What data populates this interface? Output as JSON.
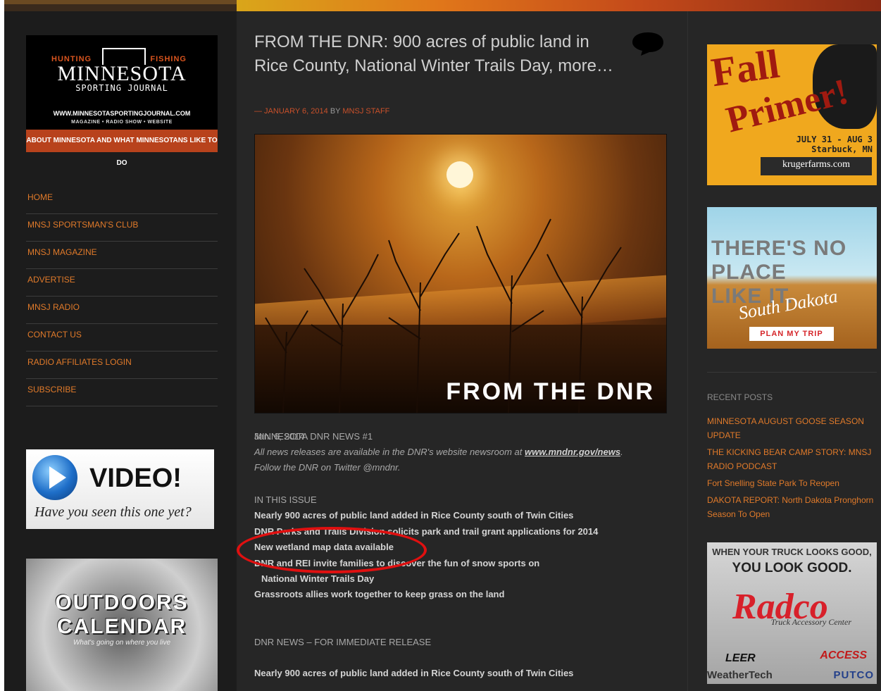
{
  "logo": {
    "hunting": "HUNTING",
    "fishing": "FISHING",
    "title": "MINNESOTA",
    "subtitle": "SPORTING JOURNAL",
    "url": "WWW.MINNESOTASPORTINGJOURNAL.COM",
    "tags": "MAGAZINE • RADIO SHOW • WEBSITE",
    "tagline": "ABOUT MINNESOTA AND WHAT MINNESOTANS LIKE TO DO"
  },
  "nav": [
    {
      "label": "HOME"
    },
    {
      "label": "MNSJ SPORTSMAN'S CLUB"
    },
    {
      "label": "MNSJ MAGAZINE"
    },
    {
      "label": "ADVERTISE"
    },
    {
      "label": "MNSJ RADIO"
    },
    {
      "label": "CONTACT US"
    },
    {
      "label": "RADIO AFFILIATES LOGIN"
    },
    {
      "label": "SUBSCRIBE"
    }
  ],
  "sidebar_ads": {
    "video_title": "VIDEO!",
    "video_sub": "Have you seen this one yet?",
    "calendar_line1": "OUTDOORS",
    "calendar_line2": "CALENDAR",
    "calendar_sub": "What's going on where you live"
  },
  "post": {
    "title": "FROM THE DNR: 900 acres of public land in Rice County, National Winter Trails Day, more…",
    "meta_date": "— JANUARY 6, 2014",
    "meta_by": "BY",
    "meta_author": "MNSJ STAFF",
    "hero_text": "FROM THE DNR",
    "news_label": "MINNESOTA DNR NEWS #1",
    "news_date": "Jan. 6, 2014",
    "intro_part1": "All news releases are available in the DNR's website newsroom at",
    "intro_link": "www.mndnr.gov/news",
    "intro_part2": ".",
    "follow": "Follow the DNR on Twitter @mndnr.",
    "issue_heading": "IN THIS ISSUE",
    "issue_items": [
      "Nearly 900 acres of public land added in Rice County south of Twin Cities",
      "DNR Parks and Trails Division solicits park and trail grant applications for 2014",
      "New wetland map data available",
      "DNR and REI invite families to discover the fun of snow sports on",
      "National Winter Trails Day",
      "Grassroots allies work together to keep grass on the land"
    ],
    "release_heading": "DNR NEWS – FOR IMMEDIATE RELEASE",
    "first_story": "Nearly 900 acres of public land added in Rice County south of Twin Cities"
  },
  "right_ads": {
    "fall_line1": "Fall",
    "fall_line2": "Primer!",
    "fall_dates": "JULY 31 - AUG 3",
    "fall_place": "Starbuck, MN",
    "fall_site": "krugerfarms.com",
    "sd_line1": "THERE'S NO PLACE",
    "sd_line2": "LIKE IT.",
    "sd_brand": "South Dakota",
    "sd_button": "PLAN MY TRIP",
    "radco_line1": "WHEN YOUR TRUCK LOOKS GOOD,",
    "radco_line2": "YOU LOOK GOOD.",
    "radco_brand": "Radco",
    "radco_sub": "Truck Accessory Center",
    "radco_leer": "LEER",
    "radco_access": "ACCESS",
    "radco_weathertech": "WeatherTech",
    "radco_putco": "PUTCO"
  },
  "recent": {
    "heading": "RECENT POSTS",
    "items": [
      "MINNESOTA AUGUST GOOSE SEASON UPDATE",
      "THE KICKING BEAR CAMP STORY: MNSJ RADIO PODCAST",
      "Fort Snelling State Park To Reopen",
      "DAKOTA REPORT: North Dakota Pronghorn Season To Open"
    ]
  }
}
